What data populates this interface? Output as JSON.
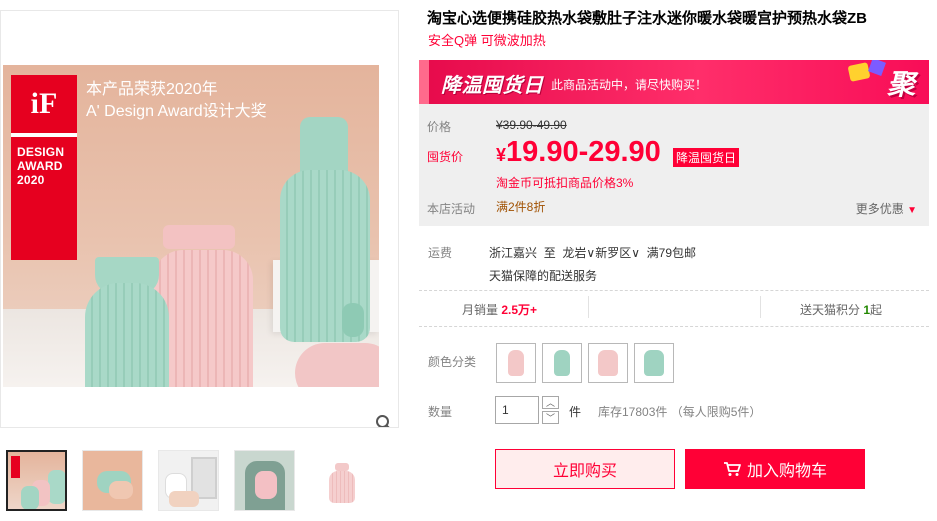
{
  "product": {
    "title": "淘宝心选便携硅胶热水袋敷肚子注水迷你暖水袋暖宫护预热水袋ZB",
    "subtitle": "安全Q弹 可微波加热"
  },
  "gallery": {
    "hero_headline_1": "本产品荣获2020年",
    "hero_headline_2": "A' Design Award设计大奖",
    "badge_logo": "iF",
    "badge_line1": "DESIGN",
    "badge_line2": "AWARD",
    "badge_line3": "2020",
    "zoom_icon": "magnifier-icon",
    "thumbnail_count": 5
  },
  "promo": {
    "event_name": "降温囤货日",
    "note": "此商品活动中，请尽快购买！",
    "brand_mark": "聚",
    "colors": {
      "banner": "#ff2e6a",
      "accent": "#ff0036"
    }
  },
  "pricing": {
    "orig_label": "价格",
    "orig_price": "¥39.90-49.90",
    "cur_label": "囤货价",
    "yen": "¥",
    "cur_price": "19.90-29.90",
    "cur_tag": "降温囤货日",
    "coins_note": "淘金币可抵扣商品价格3%",
    "store_label": "本店活动",
    "store_value": "满2件8折",
    "more_offers": "更多优惠"
  },
  "shipping": {
    "label": "运费",
    "from": "浙江嘉兴",
    "to_word": "至",
    "city": "龙岩",
    "district": "新罗区",
    "free_note": "满79包邮",
    "service": "天猫保障的配送服务"
  },
  "stats": {
    "monthly_label": "月销量",
    "monthly_value": "2.5万+",
    "points_label": "送天猫积分",
    "points_value": "1",
    "points_suffix": "起"
  },
  "options": {
    "color_label": "颜色分类",
    "swatches": [
      "pink",
      "green",
      "pink",
      "green"
    ],
    "qty_label": "数量",
    "qty_value": "1",
    "qty_unit": "件",
    "stock_text": "库存17803件 （每人限购5件）"
  },
  "actions": {
    "buy_now": "立即购买",
    "add_to_cart": "加入购物车"
  }
}
